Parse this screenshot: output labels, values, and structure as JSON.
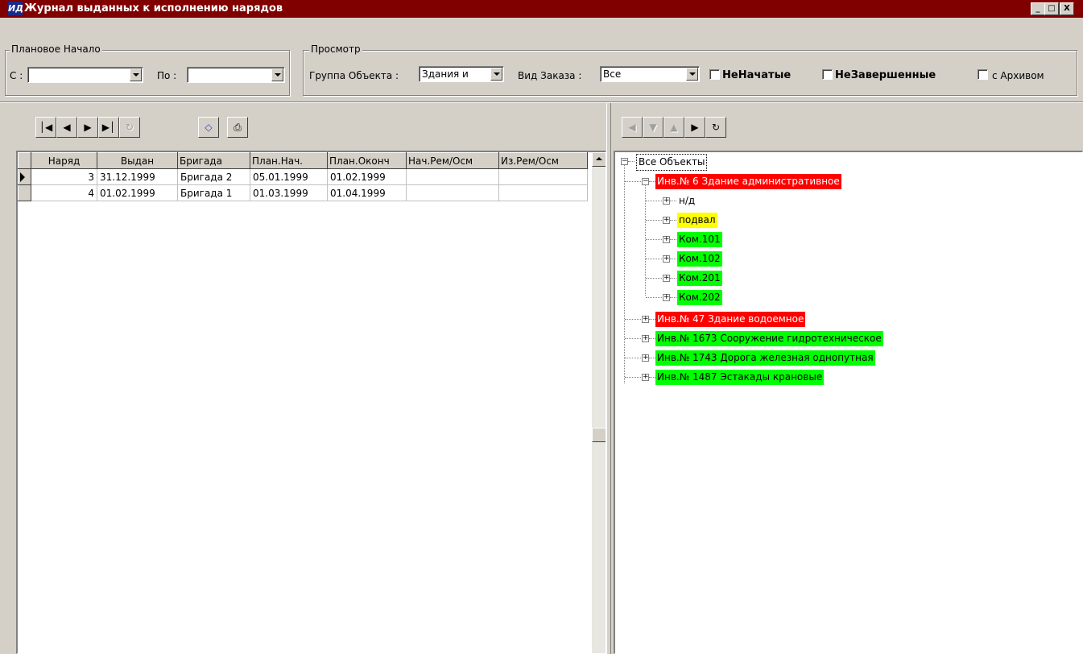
{
  "window": {
    "title": "Журнал выданных  к исполнению нарядов",
    "app_icon_text": "ИД",
    "minimize": "_",
    "maximize": "□",
    "close": "X"
  },
  "filter_planned": {
    "legend": "Плановое Начало",
    "from_label": "С :",
    "to_label": "По :",
    "from_value": "",
    "to_value": ""
  },
  "filter_view": {
    "legend": "Просмотр",
    "object_group_label": "Группа Объекта :",
    "object_group_value": "Здания и",
    "order_type_label": "Вид Заказа :",
    "order_type_value": "Все",
    "not_started_label": "НеНачатые",
    "not_finished_label": "НеЗавершенные",
    "archive_label": "с Архивом",
    "not_started_checked": false,
    "not_finished_checked": false,
    "archive_checked": false
  },
  "left_toolbar": {
    "first_icon": "first-record-icon",
    "prior_icon": "prior-record-icon",
    "next_icon": "next-record-icon",
    "last_icon": "last-record-icon",
    "refresh_icon": "refresh-icon",
    "open_icon": "open-book-icon",
    "print_icon": "printer-icon"
  },
  "grid": {
    "columns": [
      "Наряд",
      "Выдан",
      "Бригада",
      "План.Нач.",
      "План.Оконч",
      "Нач.Рем/Осм",
      "Из.Рем/Осм"
    ],
    "rows": [
      [
        "3",
        "31.12.1999",
        "Бригада 2",
        "05.01.1999",
        "01.02.1999",
        "",
        ""
      ],
      [
        "4",
        "01.02.1999",
        "Бригада 1",
        "01.03.1999",
        "01.04.1999",
        "",
        ""
      ]
    ],
    "current_row": 0
  },
  "tree": {
    "root": "Все Объекты",
    "nodes": [
      {
        "label": "Инв.№ 6 Здание административное",
        "color": "#ff0000",
        "text_color": "#ffffff",
        "expanded": true,
        "children": [
          {
            "label": "н/д",
            "color": "",
            "text_color": "#000000"
          },
          {
            "label": "подвал",
            "color": "#ffff00",
            "text_color": "#000000"
          },
          {
            "label": "Ком.101",
            "color": "#00ff00",
            "text_color": "#000000"
          },
          {
            "label": "Ком.102",
            "color": "#00ff00",
            "text_color": "#000000"
          },
          {
            "label": "Ком.201",
            "color": "#00ff00",
            "text_color": "#000000"
          },
          {
            "label": "Ком.202",
            "color": "#00ff00",
            "text_color": "#000000"
          }
        ]
      },
      {
        "label": "Инв.№ 47 Здание водоемное",
        "color": "#ff0000",
        "text_color": "#ffffff",
        "expanded": false
      },
      {
        "label": "Инв.№ 1673 Сооружение гидротехническое",
        "color": "#00ff00",
        "text_color": "#000000",
        "expanded": false
      },
      {
        "label": "Инв.№ 1743 Дорога железная однопутная",
        "color": "#00ff00",
        "text_color": "#000000",
        "expanded": false
      },
      {
        "label": "Инв.№ 1487 Эстакады крановые",
        "color": "#00ff00",
        "text_color": "#000000",
        "expanded": false
      }
    ]
  },
  "colors": {
    "titlebar": "#800000",
    "face": "#d4d0c8"
  }
}
